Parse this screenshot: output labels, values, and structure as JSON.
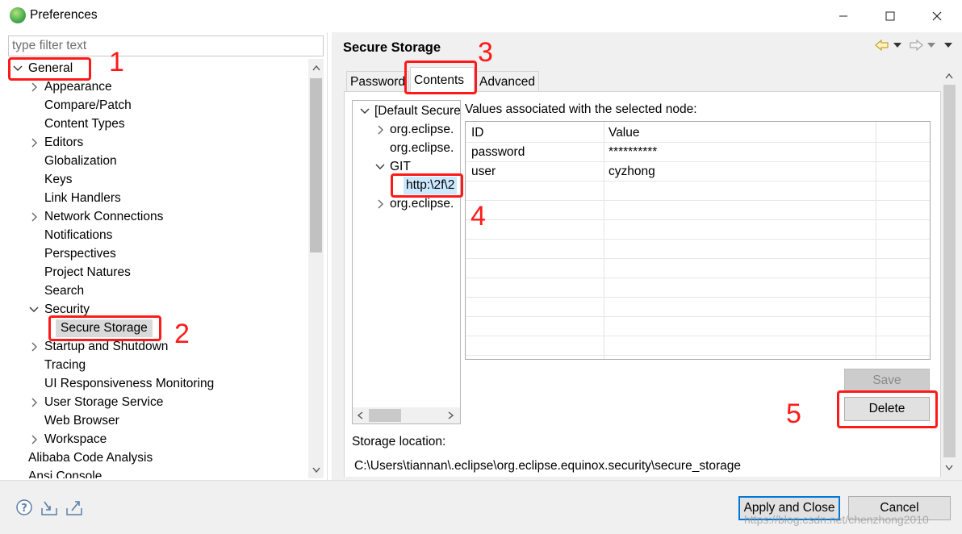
{
  "window": {
    "title": "Preferences"
  },
  "filter": {
    "placeholder": "type filter text"
  },
  "left_tree": {
    "items": [
      {
        "label": "General"
      },
      {
        "label": "Appearance"
      },
      {
        "label": "Compare/Patch"
      },
      {
        "label": "Content Types"
      },
      {
        "label": "Editors"
      },
      {
        "label": "Globalization"
      },
      {
        "label": "Keys"
      },
      {
        "label": "Link Handlers"
      },
      {
        "label": "Network Connections"
      },
      {
        "label": "Notifications"
      },
      {
        "label": "Perspectives"
      },
      {
        "label": "Project Natures"
      },
      {
        "label": "Search"
      },
      {
        "label": "Security"
      },
      {
        "label": "Secure Storage"
      },
      {
        "label": "Startup and Shutdown"
      },
      {
        "label": "Tracing"
      },
      {
        "label": "UI Responsiveness Monitoring"
      },
      {
        "label": "User Storage Service"
      },
      {
        "label": "Web Browser"
      },
      {
        "label": "Workspace"
      },
      {
        "label": "Alibaba Code Analysis"
      },
      {
        "label": "Ansi Console"
      }
    ]
  },
  "page": {
    "title": "Secure Storage",
    "tabs": [
      {
        "label": "Password"
      },
      {
        "label": "Contents"
      },
      {
        "label": "Advanced"
      }
    ],
    "storage_tree": [
      {
        "label": "[Default Secure"
      },
      {
        "label": "org.eclipse."
      },
      {
        "label": "org.eclipse."
      },
      {
        "label": "GIT"
      },
      {
        "label": "http:\\2f\\2"
      },
      {
        "label": "org.eclipse."
      }
    ],
    "values_label": "Values associated with the selected node:",
    "table": {
      "headers": [
        "ID",
        "Value"
      ],
      "rows": [
        [
          "password",
          "**********"
        ],
        [
          "user",
          "cyzhong"
        ]
      ]
    },
    "save_label": "Save",
    "delete_label": "Delete",
    "storage_location_label": "Storage location:",
    "storage_path": "C:\\Users\\tiannan\\.eclipse\\org.eclipse.equinox.security\\secure_storage"
  },
  "footer": {
    "apply_label": "Apply and Close",
    "cancel_label": "Cancel",
    "watermark": "https://blog.csdn.net/chenzhong2010"
  },
  "annotations": {
    "color": "#ff1a1a",
    "numbers": [
      "1",
      "2",
      "3",
      "4",
      "5"
    ]
  },
  "icons": [
    "eclipse-app-icon",
    "minimize-icon",
    "maximize-icon",
    "close-icon",
    "back-icon",
    "dropdown-icon",
    "forward-icon",
    "view-menu-icon",
    "help-icon",
    "import-icon",
    "export-icon"
  ]
}
